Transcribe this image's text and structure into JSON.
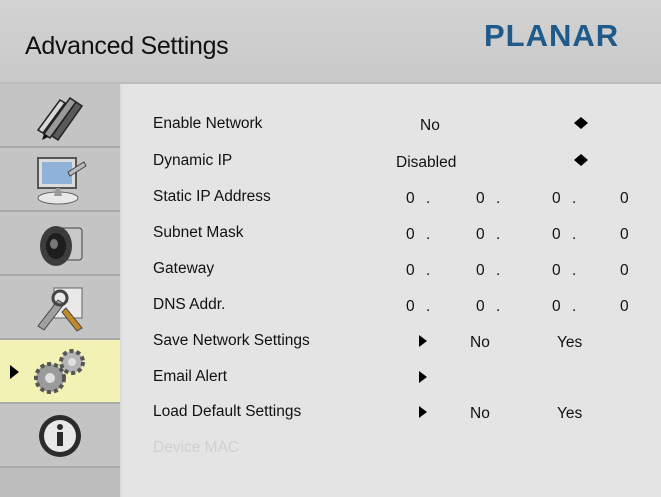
{
  "header": {
    "title": "Advanced Settings",
    "logo": "PLANAR"
  },
  "sidebar": {
    "items": [
      {
        "icon": "pens-icon",
        "active": false
      },
      {
        "icon": "monitor-icon",
        "active": false
      },
      {
        "icon": "speaker-icon",
        "active": false
      },
      {
        "icon": "tools-icon",
        "active": false
      },
      {
        "icon": "gears-icon",
        "active": true
      },
      {
        "icon": "info-icon",
        "active": false
      }
    ]
  },
  "settings": {
    "enable_network": {
      "label": "Enable Network",
      "value": "No"
    },
    "dynamic_ip": {
      "label": "Dynamic IP",
      "value": "Disabled"
    },
    "static_ip": {
      "label": "Static IP Address",
      "octets": [
        "0",
        "0",
        "0",
        "0"
      ]
    },
    "subnet_mask": {
      "label": "Subnet Mask",
      "octets": [
        "0",
        "0",
        "0",
        "0"
      ]
    },
    "gateway": {
      "label": "Gateway",
      "octets": [
        "0",
        "0",
        "0",
        "0"
      ]
    },
    "dns": {
      "label": "DNS Addr.",
      "octets": [
        "0",
        "0",
        "0",
        "0"
      ]
    },
    "save_network": {
      "label": "Save Network Settings",
      "no": "No",
      "yes": "Yes"
    },
    "email_alert": {
      "label": "Email Alert"
    },
    "load_default": {
      "label": "Load Default Settings",
      "no": "No",
      "yes": "Yes"
    },
    "device_mac": {
      "label": "Device MAC"
    },
    "dot": "."
  }
}
